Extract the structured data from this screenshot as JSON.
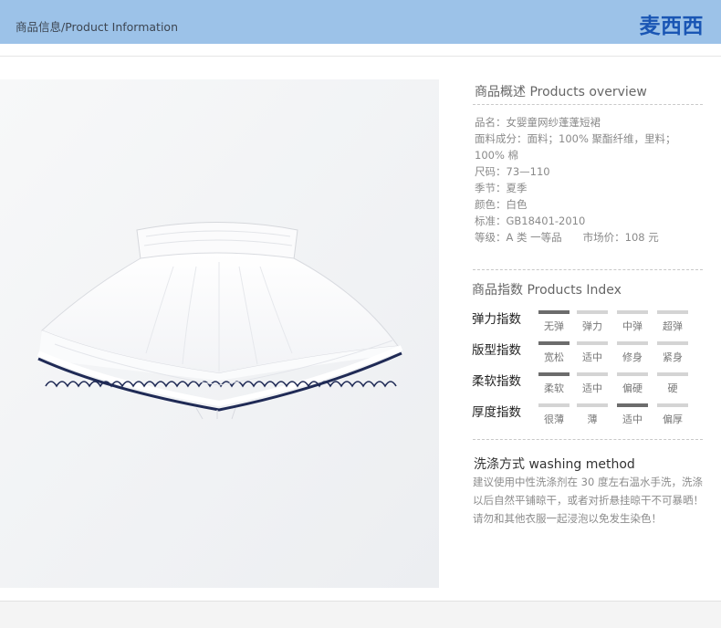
{
  "header": {
    "title": "商品信息/Product Information",
    "brand": "麦西西",
    "brand_color": "#1a56b4",
    "band_color": "#9cc2e8"
  },
  "overview": {
    "title": "商品概述 Products overview",
    "lines": [
      "品名：女婴童网纱蓬蓬短裙",
      "面料成分：面料；100% 聚酯纤维，里料；",
      "100% 棉",
      "尺码：73—110",
      "季节：夏季",
      "颜色：白色",
      "标准：GB18401-2010",
      "等级：A 类 一等品　　市场价：108 元"
    ]
  },
  "index": {
    "title": "商品指数 Products Index",
    "rows": [
      {
        "label": "弹力指数",
        "options": [
          "无弹",
          "弹力",
          "中弹",
          "超弹"
        ],
        "selected": "无弹"
      },
      {
        "label": "版型指数",
        "options": [
          "宽松",
          "适中",
          "修身",
          "紧身"
        ],
        "selected": "宽松"
      },
      {
        "label": "柔软指数",
        "options": [
          "柔软",
          "适中",
          "偏硬",
          "硬"
        ],
        "selected": "柔软"
      },
      {
        "label": "厚度指数",
        "options": [
          "很薄",
          "薄",
          "适中",
          "偏厚"
        ],
        "selected": "适中"
      }
    ]
  },
  "washing": {
    "title": "洗涤方式 washing method",
    "text": "建议使用中性洗涤剂在 30 度左右温水手洗，洗涤以后自然平铺晾干，或者对折悬挂晾干不可暴晒！请勿和其他衣服一起浸泡以免发生染色！"
  },
  "product_image": "white-tutu-skirt-with-navy-ruffle-trim"
}
